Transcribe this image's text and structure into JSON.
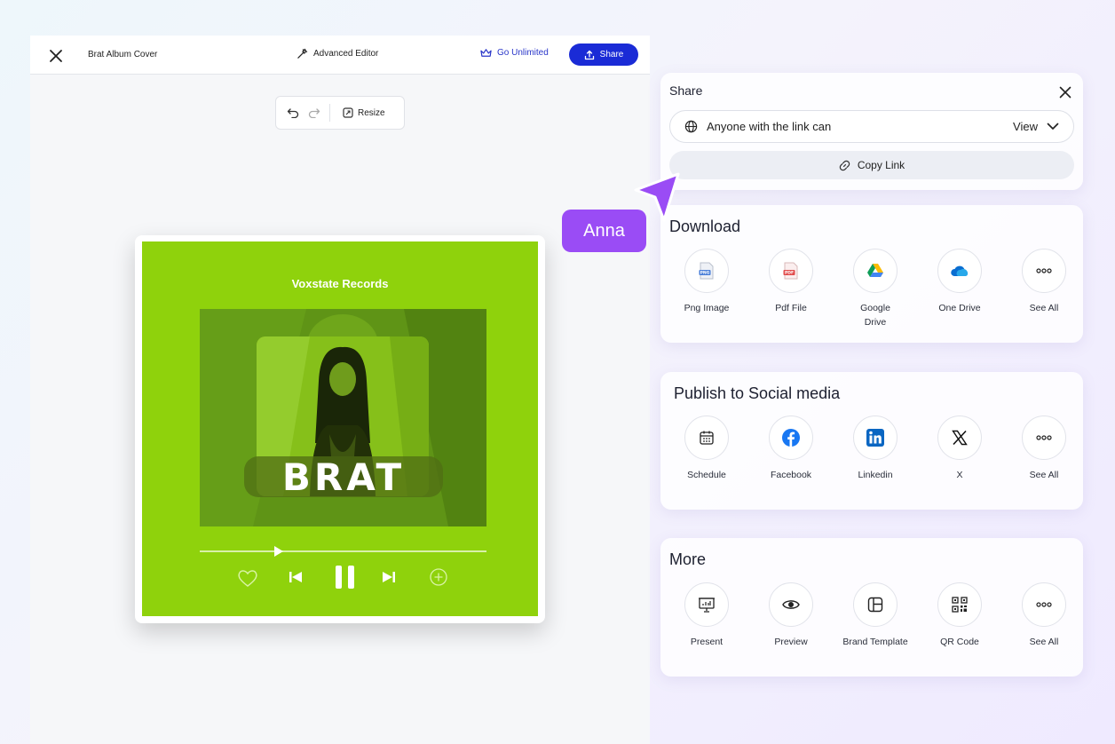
{
  "editor": {
    "doc_title": "Brat Album Cover",
    "advanced_editor": "Advanced Editor",
    "go_unlimited": "Go Unlimited",
    "share_button": "Share",
    "resize": "Resize"
  },
  "cover": {
    "label": "Voxstate Records",
    "title": "BRAT",
    "accent_color": "#8fd20c",
    "playback_progress": 0.26
  },
  "share": {
    "title": "Share",
    "link_access": "Anyone with the link can",
    "permission": "View",
    "copy_link": "Copy Link"
  },
  "download": {
    "title": "Download",
    "options": [
      {
        "icon": "png-file-icon",
        "label": "Png Image"
      },
      {
        "icon": "pdf-file-icon",
        "label": "Pdf File"
      },
      {
        "icon": "google-drive-icon",
        "label": "Google Drive"
      },
      {
        "icon": "onedrive-icon",
        "label": "One Drive"
      },
      {
        "icon": "more-dots-icon",
        "label": "See All"
      }
    ]
  },
  "social": {
    "title": "Publish to Social media",
    "options": [
      {
        "icon": "calendar-icon",
        "label": "Schedule"
      },
      {
        "icon": "facebook-icon",
        "label": "Facebook"
      },
      {
        "icon": "linkedin-icon",
        "label": "Linkedin"
      },
      {
        "icon": "x-logo-icon",
        "label": "X"
      },
      {
        "icon": "more-dots-icon",
        "label": "See All"
      }
    ]
  },
  "more": {
    "title": "More",
    "options": [
      {
        "icon": "presentation-icon",
        "label": "Present"
      },
      {
        "icon": "eye-icon",
        "label": "Preview"
      },
      {
        "icon": "layout-template-icon",
        "label": "Brand Template"
      },
      {
        "icon": "qr-code-icon",
        "label": "QR Code"
      },
      {
        "icon": "more-dots-icon",
        "label": "See All"
      }
    ]
  },
  "collaborator": {
    "name": "Anna",
    "color": "#9a4cf5"
  }
}
